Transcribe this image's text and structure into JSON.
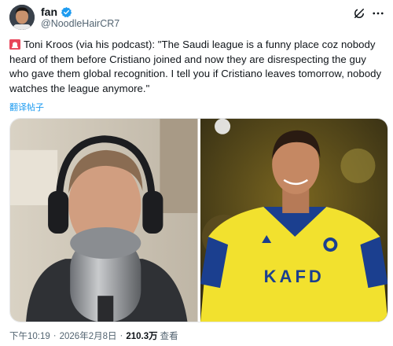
{
  "author": {
    "display_name": "fan",
    "handle": "@NoodleHairCR7",
    "verified_color": "#1d9bf0"
  },
  "header_icons": [
    "grok-icon",
    "more-icon"
  ],
  "tweet": {
    "emoji": "siren",
    "text": "Toni Kroos (via his podcast): \"The Saudi league is a funny place coz nobody heard of them before Cristiano joined and now they are disrespecting the guy who gave them global recognition. I tell you if Cristiano leaves tomorrow, nobody watches the league anymore.\"",
    "translate_label": "翻译帖子"
  },
  "media": {
    "photo_left": "Man wearing headphones speaking into a podcast microphone",
    "photo_right": "Footballer in yellow Al Nassr kit smiling",
    "jersey_sponsor": "KAFD"
  },
  "footer": {
    "time": "下午10:19",
    "date": "2026年2月8日",
    "views": "210.3万",
    "views_label": "查看",
    "separator": "·"
  }
}
